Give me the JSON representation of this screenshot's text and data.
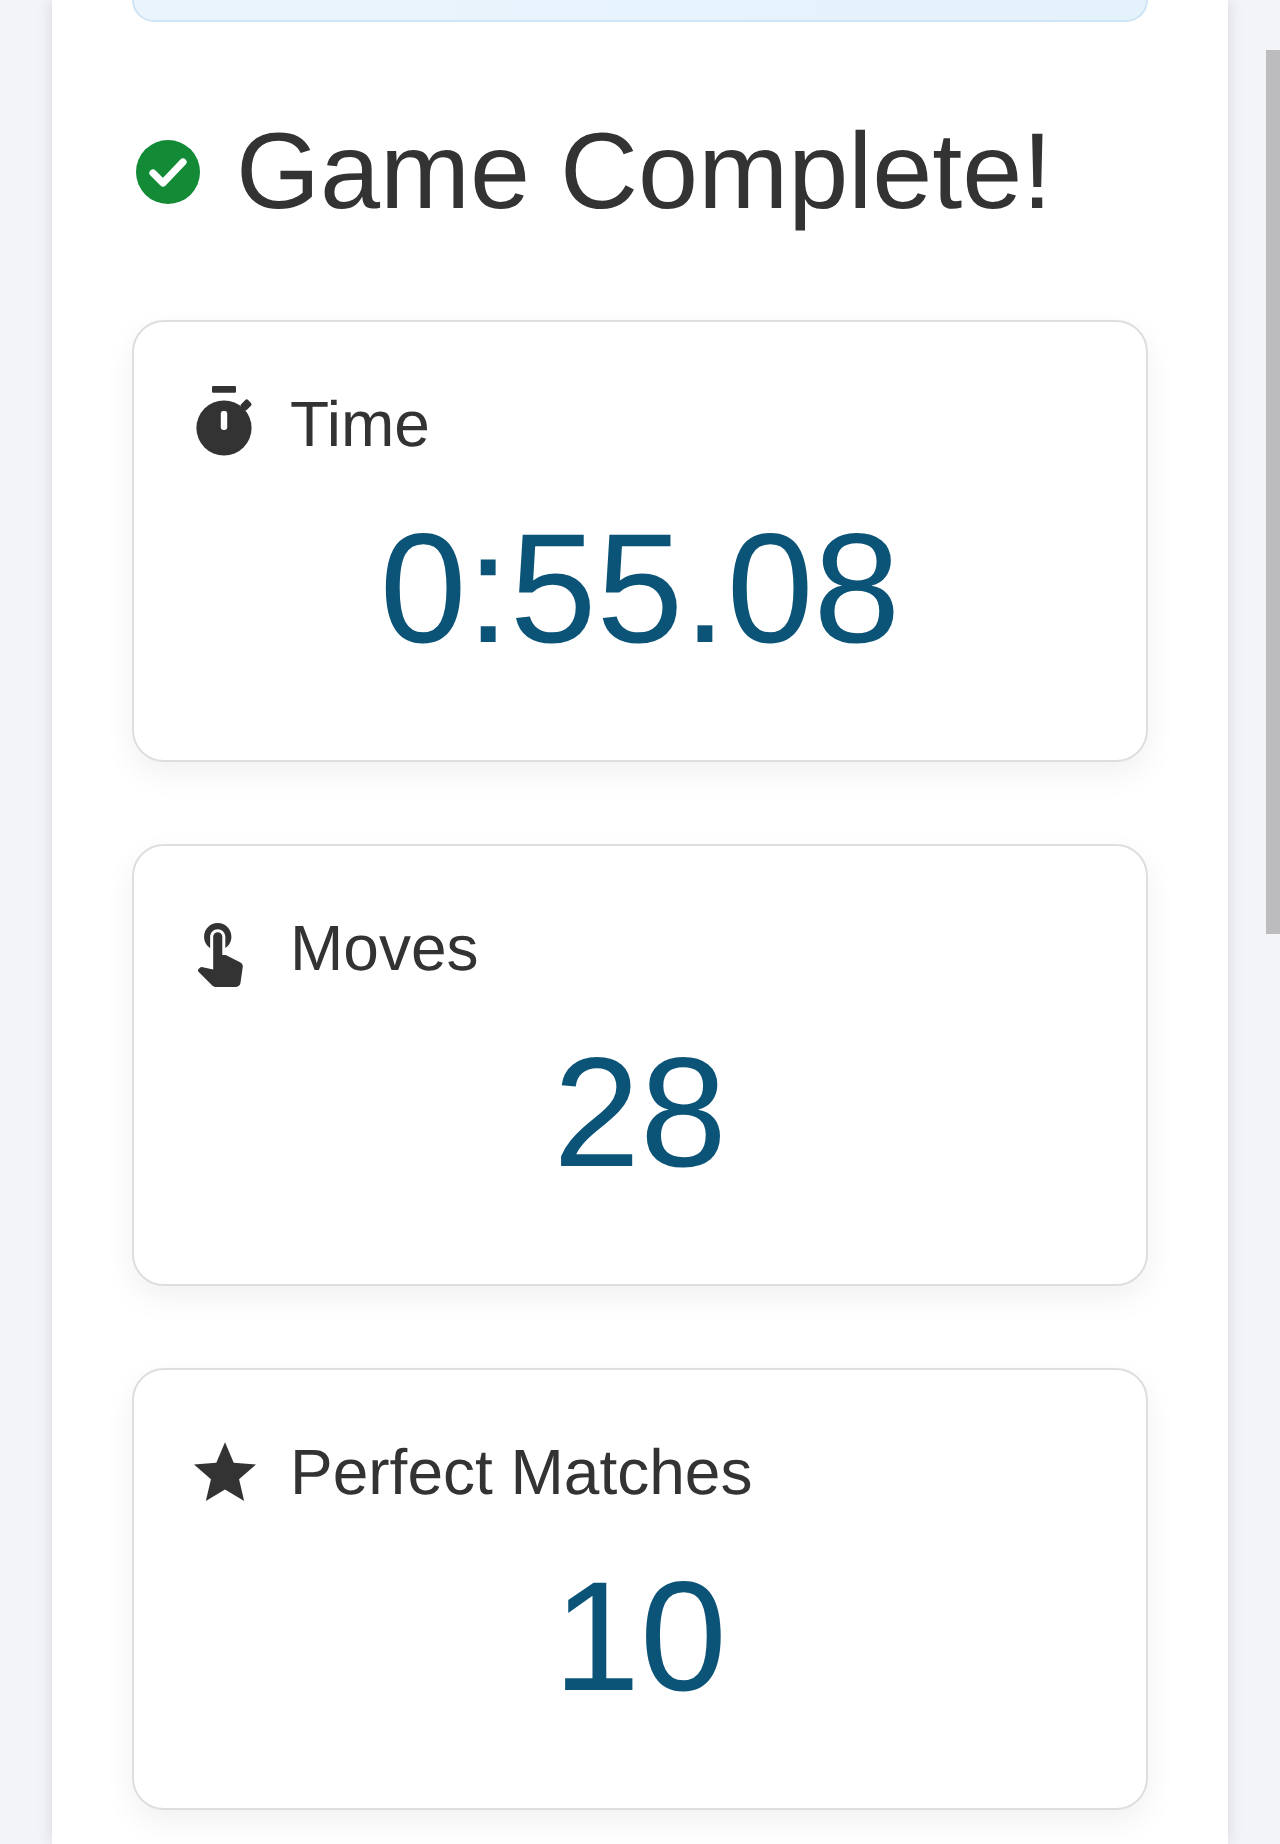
{
  "heading": {
    "title": "Game Complete!"
  },
  "stats": [
    {
      "kind": "time",
      "label": "Time",
      "value": "0:55.08"
    },
    {
      "kind": "moves",
      "label": "Moves",
      "value": "28"
    },
    {
      "kind": "perfect",
      "label": "Perfect Matches",
      "value": "10"
    }
  ]
}
